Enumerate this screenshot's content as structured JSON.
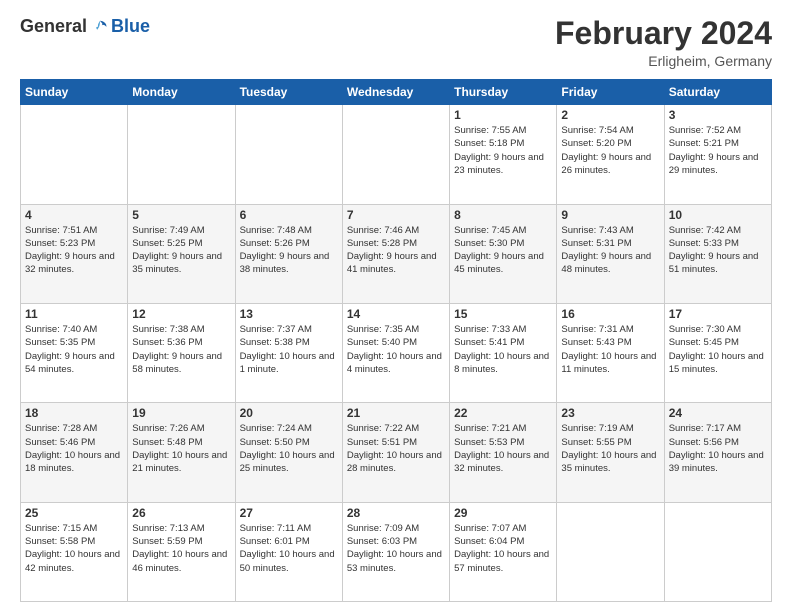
{
  "header": {
    "logo": {
      "general": "General",
      "blue": "Blue"
    },
    "title": "February 2024",
    "subtitle": "Erligheim, Germany"
  },
  "calendar": {
    "weekdays": [
      "Sunday",
      "Monday",
      "Tuesday",
      "Wednesday",
      "Thursday",
      "Friday",
      "Saturday"
    ],
    "weeks": [
      [
        {
          "day": "",
          "info": ""
        },
        {
          "day": "",
          "info": ""
        },
        {
          "day": "",
          "info": ""
        },
        {
          "day": "",
          "info": ""
        },
        {
          "day": "1",
          "info": "Sunrise: 7:55 AM\nSunset: 5:18 PM\nDaylight: 9 hours\nand 23 minutes."
        },
        {
          "day": "2",
          "info": "Sunrise: 7:54 AM\nSunset: 5:20 PM\nDaylight: 9 hours\nand 26 minutes."
        },
        {
          "day": "3",
          "info": "Sunrise: 7:52 AM\nSunset: 5:21 PM\nDaylight: 9 hours\nand 29 minutes."
        }
      ],
      [
        {
          "day": "4",
          "info": "Sunrise: 7:51 AM\nSunset: 5:23 PM\nDaylight: 9 hours\nand 32 minutes."
        },
        {
          "day": "5",
          "info": "Sunrise: 7:49 AM\nSunset: 5:25 PM\nDaylight: 9 hours\nand 35 minutes."
        },
        {
          "day": "6",
          "info": "Sunrise: 7:48 AM\nSunset: 5:26 PM\nDaylight: 9 hours\nand 38 minutes."
        },
        {
          "day": "7",
          "info": "Sunrise: 7:46 AM\nSunset: 5:28 PM\nDaylight: 9 hours\nand 41 minutes."
        },
        {
          "day": "8",
          "info": "Sunrise: 7:45 AM\nSunset: 5:30 PM\nDaylight: 9 hours\nand 45 minutes."
        },
        {
          "day": "9",
          "info": "Sunrise: 7:43 AM\nSunset: 5:31 PM\nDaylight: 9 hours\nand 48 minutes."
        },
        {
          "day": "10",
          "info": "Sunrise: 7:42 AM\nSunset: 5:33 PM\nDaylight: 9 hours\nand 51 minutes."
        }
      ],
      [
        {
          "day": "11",
          "info": "Sunrise: 7:40 AM\nSunset: 5:35 PM\nDaylight: 9 hours\nand 54 minutes."
        },
        {
          "day": "12",
          "info": "Sunrise: 7:38 AM\nSunset: 5:36 PM\nDaylight: 9 hours\nand 58 minutes."
        },
        {
          "day": "13",
          "info": "Sunrise: 7:37 AM\nSunset: 5:38 PM\nDaylight: 10 hours\nand 1 minute."
        },
        {
          "day": "14",
          "info": "Sunrise: 7:35 AM\nSunset: 5:40 PM\nDaylight: 10 hours\nand 4 minutes."
        },
        {
          "day": "15",
          "info": "Sunrise: 7:33 AM\nSunset: 5:41 PM\nDaylight: 10 hours\nand 8 minutes."
        },
        {
          "day": "16",
          "info": "Sunrise: 7:31 AM\nSunset: 5:43 PM\nDaylight: 10 hours\nand 11 minutes."
        },
        {
          "day": "17",
          "info": "Sunrise: 7:30 AM\nSunset: 5:45 PM\nDaylight: 10 hours\nand 15 minutes."
        }
      ],
      [
        {
          "day": "18",
          "info": "Sunrise: 7:28 AM\nSunset: 5:46 PM\nDaylight: 10 hours\nand 18 minutes."
        },
        {
          "day": "19",
          "info": "Sunrise: 7:26 AM\nSunset: 5:48 PM\nDaylight: 10 hours\nand 21 minutes."
        },
        {
          "day": "20",
          "info": "Sunrise: 7:24 AM\nSunset: 5:50 PM\nDaylight: 10 hours\nand 25 minutes."
        },
        {
          "day": "21",
          "info": "Sunrise: 7:22 AM\nSunset: 5:51 PM\nDaylight: 10 hours\nand 28 minutes."
        },
        {
          "day": "22",
          "info": "Sunrise: 7:21 AM\nSunset: 5:53 PM\nDaylight: 10 hours\nand 32 minutes."
        },
        {
          "day": "23",
          "info": "Sunrise: 7:19 AM\nSunset: 5:55 PM\nDaylight: 10 hours\nand 35 minutes."
        },
        {
          "day": "24",
          "info": "Sunrise: 7:17 AM\nSunset: 5:56 PM\nDaylight: 10 hours\nand 39 minutes."
        }
      ],
      [
        {
          "day": "25",
          "info": "Sunrise: 7:15 AM\nSunset: 5:58 PM\nDaylight: 10 hours\nand 42 minutes."
        },
        {
          "day": "26",
          "info": "Sunrise: 7:13 AM\nSunset: 5:59 PM\nDaylight: 10 hours\nand 46 minutes."
        },
        {
          "day": "27",
          "info": "Sunrise: 7:11 AM\nSunset: 6:01 PM\nDaylight: 10 hours\nand 50 minutes."
        },
        {
          "day": "28",
          "info": "Sunrise: 7:09 AM\nSunset: 6:03 PM\nDaylight: 10 hours\nand 53 minutes."
        },
        {
          "day": "29",
          "info": "Sunrise: 7:07 AM\nSunset: 6:04 PM\nDaylight: 10 hours\nand 57 minutes."
        },
        {
          "day": "",
          "info": ""
        },
        {
          "day": "",
          "info": ""
        }
      ]
    ]
  }
}
